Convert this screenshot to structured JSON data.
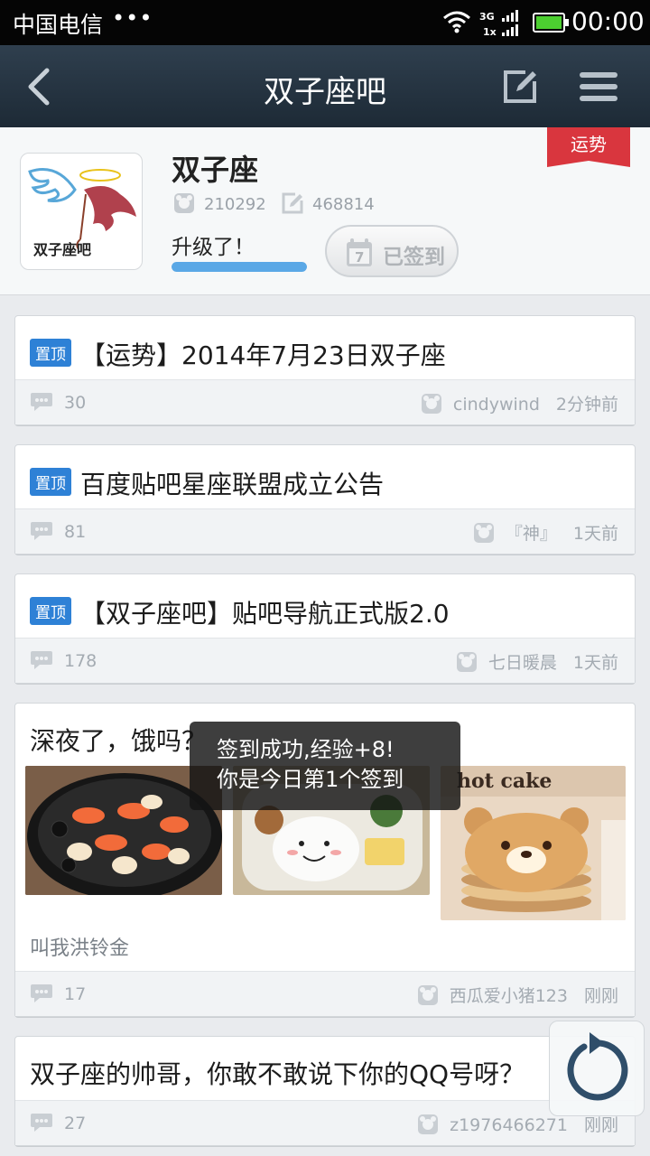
{
  "status_bar": {
    "carrier": "中国电信",
    "dots": "•••",
    "network": "3G",
    "network2": "1x",
    "time": "00:00"
  },
  "nav": {
    "title": "双子座吧"
  },
  "forum": {
    "name": "双子座",
    "avatar_text": "双子座吧",
    "members": "210292",
    "posts": "468814",
    "level_text": "升级了！",
    "level_progress": 1.0,
    "sign_label": "已签到",
    "sign_day": "7",
    "fortune_tag": "运势"
  },
  "posts": [
    {
      "pinned": true,
      "pin_label": "置顶",
      "title": "【运势】2014年7月23日双子座",
      "replies": "30",
      "author": "cindywind",
      "time": "2分钟前"
    },
    {
      "pinned": true,
      "pin_label": "置顶",
      "title": "百度贴吧星座联盟成立公告",
      "replies": "81",
      "author": "『神』",
      "time": "1天前"
    },
    {
      "pinned": true,
      "pin_label": "置顶",
      "title": "【双子座吧】贴吧导航正式版2.0",
      "replies": "178",
      "author": "七日暖晨",
      "time": "1天前"
    },
    {
      "pinned": false,
      "title": "深夜了，饿吗？",
      "preview": "叫我洪铃金",
      "image3_text": "hot cake",
      "replies": "17",
      "author": "西瓜爱小猪123",
      "time": "刚刚"
    },
    {
      "pinned": false,
      "title": "双子座的帅哥，你敢不敢说下你的QQ号呀？",
      "replies": "27",
      "author": "z1976466271",
      "time": "刚刚"
    }
  ],
  "toast": {
    "line1": "签到成功,经验+8!",
    "line2": "你是今日第1个签到"
  },
  "colors": {
    "accent": "#2e81d6",
    "nav_bg": "#26343f",
    "ribbon": "#d9363e",
    "progress": "#5aa8e6"
  }
}
